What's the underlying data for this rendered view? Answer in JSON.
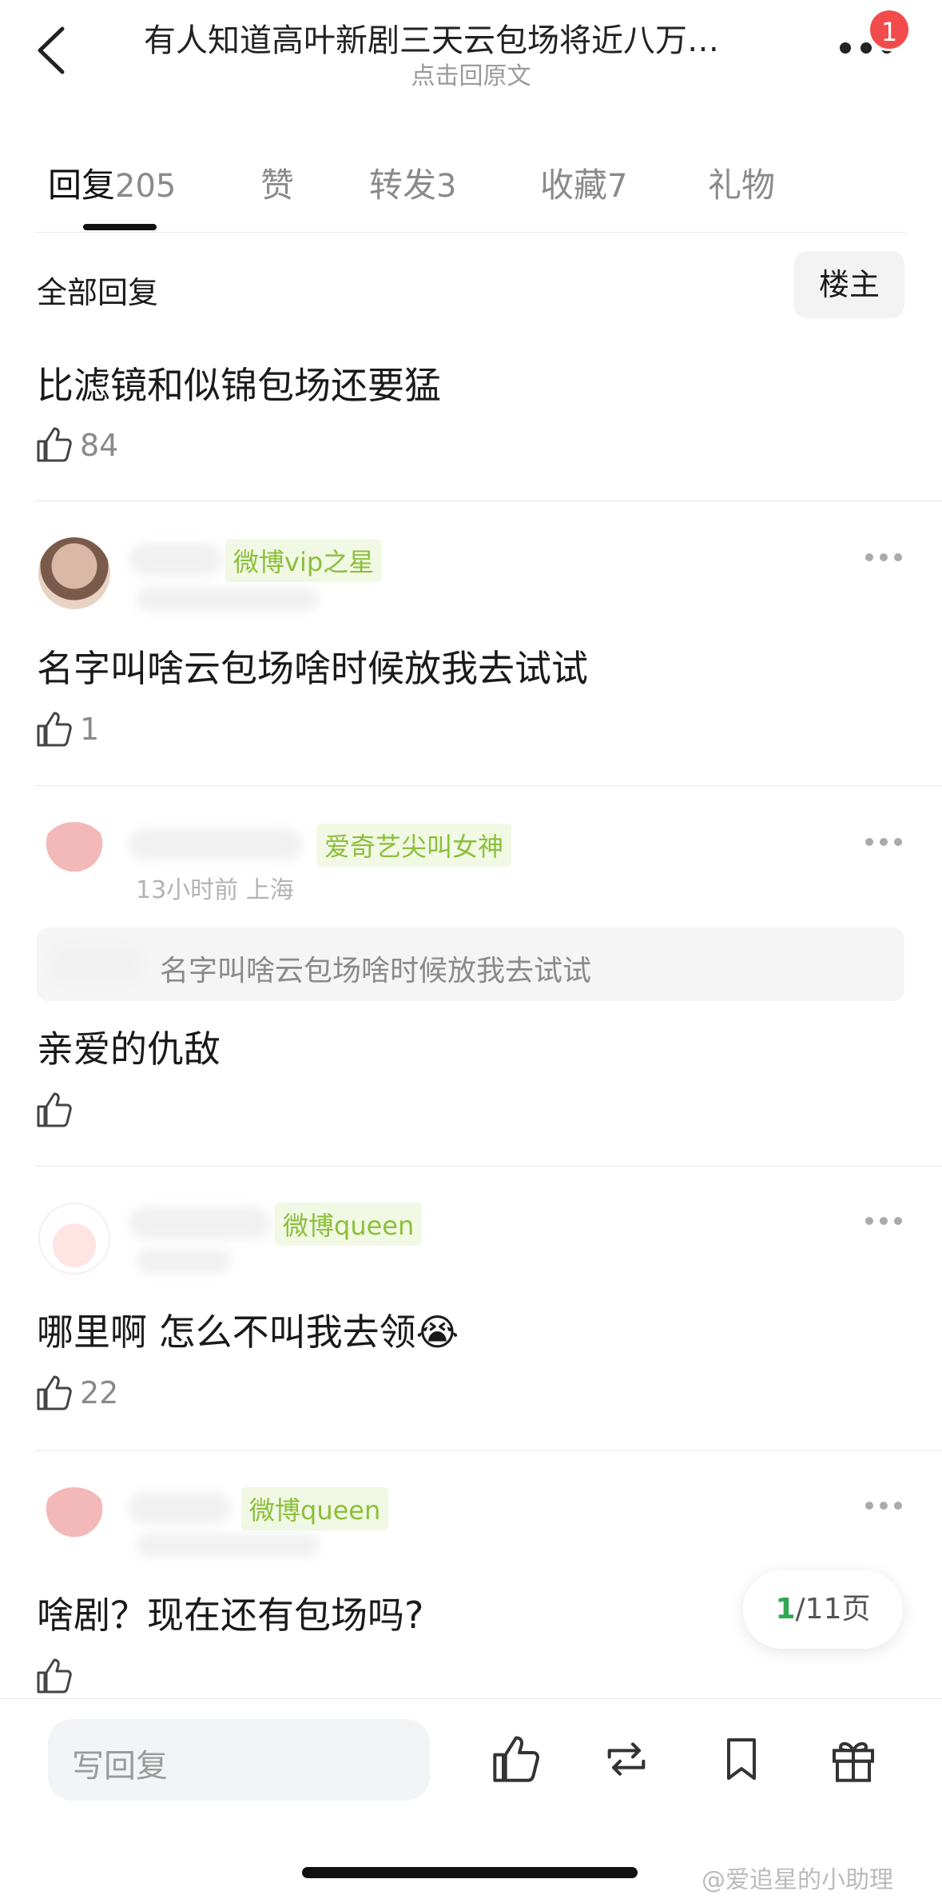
{
  "header": {
    "title": "有人知道高叶新剧三天云包场将近八万…",
    "subtitle": "点击回原文",
    "notification_count": "1"
  },
  "tabs": [
    {
      "label": "回复",
      "count": "205"
    },
    {
      "label": "赞",
      "count": ""
    },
    {
      "label": "转发",
      "count": "3"
    },
    {
      "label": "收藏",
      "count": "7"
    },
    {
      "label": "礼物",
      "count": ""
    }
  ],
  "filter": {
    "all_replies": "全部回复",
    "op_only": "楼主"
  },
  "comments": [
    {
      "text": "比滤镜和似锦包场还要猛",
      "likes": "84"
    },
    {
      "badge": "微博vip之星",
      "text": "名字叫啥云包场啥时候放我去试试",
      "likes": "1"
    },
    {
      "badge": "爱奇艺尖叫女神",
      "meta": "13小时前 上海",
      "quote": "名字叫啥云包场啥时候放我去试试",
      "text": "亲爱的仇敌",
      "likes": ""
    },
    {
      "badge": "微博queen",
      "text": "哪里啊 怎么不叫我去领😭",
      "likes": "22"
    },
    {
      "badge": "微博queen",
      "text": "啥剧？现在还有包场吗?",
      "likes": ""
    }
  ],
  "pagination": {
    "current": "1",
    "total": "/11页"
  },
  "bottom_bar": {
    "reply_placeholder": "写回复"
  },
  "watermark": "@爱追星的小助理"
}
